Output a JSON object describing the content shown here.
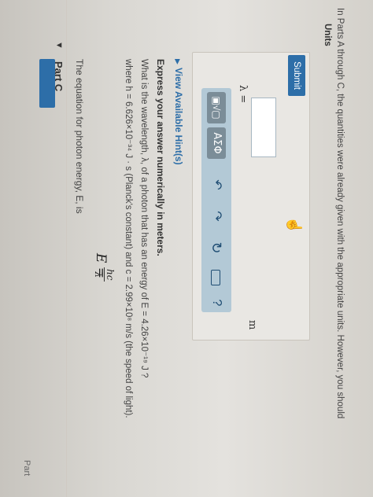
{
  "part": {
    "caret": "▼",
    "title": "Part C"
  },
  "problem": {
    "intro": "The equation for photon energy, E, is",
    "equation": {
      "lhs": "E =",
      "numerator": "hc",
      "denominator": "λ"
    },
    "given": "where h = 6.626×10⁻³⁴ J · s (Planck's constant) and c = 2.99×10⁸ m/s (the speed of light).",
    "question": "What is the wavelength, λ, of a photon that has an energy of E = 4.26×10⁻¹⁹ J ?",
    "instruction": "Express your answer numerically in meters."
  },
  "hint": {
    "caret": "▶",
    "label": "View Available Hint(s)"
  },
  "toolbar": {
    "template_label": "▣√▢",
    "greek_label": "ΑΣΦ",
    "undo_icon": "undo-icon",
    "redo_icon": "redo-icon",
    "reset_icon": "reset-icon",
    "keyboard_icon": "keyboard-icon",
    "help_label": "?"
  },
  "answer": {
    "variable_label": "λ =",
    "value": "",
    "unit": "m"
  },
  "submit": {
    "label": "Submit"
  },
  "units": {
    "title": "Units"
  },
  "footer_text": "In Parts A through C, the quantities were already given with the appropriate units. However, you should",
  "corner_text": "Part",
  "colors": {
    "accent": "#2d6ea8",
    "toolbar": "#b3c9d6",
    "panel": "#e9e7e3"
  }
}
